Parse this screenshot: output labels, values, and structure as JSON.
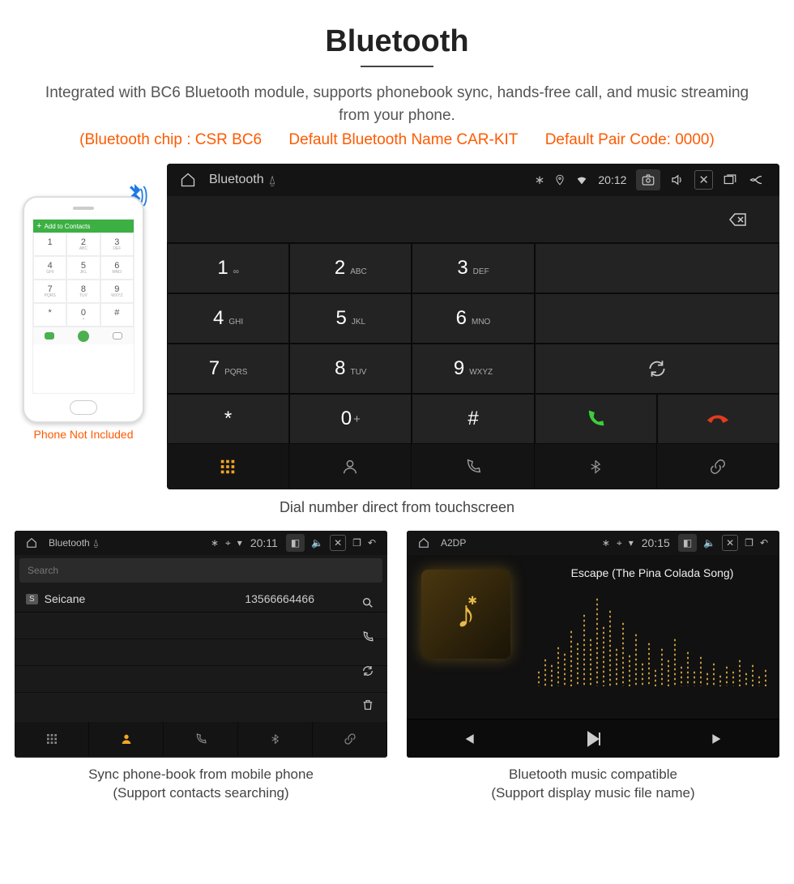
{
  "title": "Bluetooth",
  "subtitle": "Integrated with BC6 Bluetooth module, supports phonebook sync, hands-free call, and music streaming from your phone.",
  "specs": {
    "chip": "(Bluetooth chip : CSR BC6",
    "default_name": "Default Bluetooth Name CAR-KIT",
    "pair_code": "Default Pair Code: 0000)"
  },
  "phone": {
    "add_label": "Add to Contacts",
    "not_included": "Phone Not Included",
    "keys": [
      {
        "n": "1",
        "s": ""
      },
      {
        "n": "2",
        "s": "ABC"
      },
      {
        "n": "3",
        "s": "DEF"
      },
      {
        "n": "4",
        "s": "GHI"
      },
      {
        "n": "5",
        "s": "JKL"
      },
      {
        "n": "6",
        "s": "MNO"
      },
      {
        "n": "7",
        "s": "PQRS"
      },
      {
        "n": "8",
        "s": "TUV"
      },
      {
        "n": "9",
        "s": "WXYZ"
      },
      {
        "n": "*",
        "s": ""
      },
      {
        "n": "0",
        "s": "+"
      },
      {
        "n": "#",
        "s": ""
      }
    ]
  },
  "dialer": {
    "status": {
      "title": "Bluetooth",
      "time": "20:12"
    },
    "keys": [
      {
        "n": "1",
        "s": "∞"
      },
      {
        "n": "2",
        "s": "ABC"
      },
      {
        "n": "3",
        "s": "DEF"
      },
      {
        "n": "4",
        "s": "GHI"
      },
      {
        "n": "5",
        "s": "JKL"
      },
      {
        "n": "6",
        "s": "MNO"
      },
      {
        "n": "7",
        "s": "PQRS"
      },
      {
        "n": "8",
        "s": "TUV"
      },
      {
        "n": "9",
        "s": "WXYZ"
      },
      {
        "n": "*",
        "s": ""
      },
      {
        "n": "0",
        "s": "+"
      },
      {
        "n": "#",
        "s": ""
      }
    ],
    "caption": "Dial number direct from touchscreen"
  },
  "contacts": {
    "status": {
      "title": "Bluetooth",
      "time": "20:11"
    },
    "search_placeholder": "Search",
    "row": {
      "badge": "S",
      "name": "Seicane",
      "number": "13566664466"
    },
    "caption_line1": "Sync phone-book from mobile phone",
    "caption_line2": "(Support contacts searching)"
  },
  "music": {
    "status": {
      "title": "A2DP",
      "time": "20:15"
    },
    "song": "Escape (The Pina Colada Song)",
    "caption_line1": "Bluetooth music compatible",
    "caption_line2": "(Support display music file name)"
  }
}
